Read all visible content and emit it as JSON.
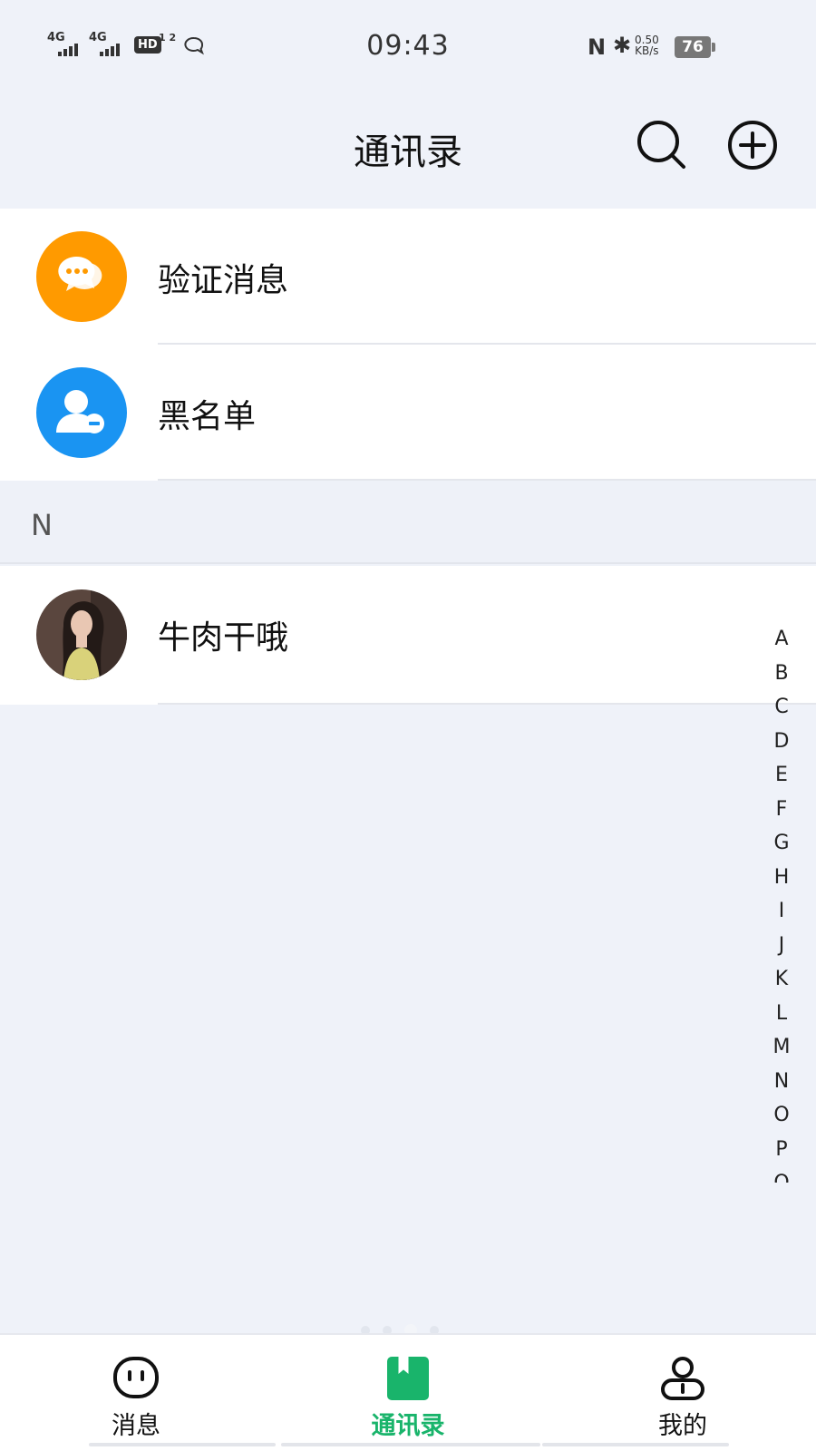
{
  "status_bar": {
    "net1": "4G",
    "net2": "4G",
    "hd": "HD",
    "hd_sub": "1 2",
    "time": "09:43",
    "nfc": "N",
    "bluetooth": "✱",
    "speed_value": "0.50",
    "speed_unit": "KB/s",
    "battery": "76"
  },
  "header": {
    "title": "通讯录"
  },
  "list": {
    "verify_label": "验证消息",
    "blacklist_label": "黑名单",
    "section_letter": "N",
    "contact_name": "牛肉干哦"
  },
  "index_letters": [
    "A",
    "B",
    "C",
    "D",
    "E",
    "F",
    "G",
    "H",
    "I",
    "J",
    "K",
    "L",
    "M",
    "N",
    "O",
    "P",
    "Q"
  ],
  "tabs": [
    {
      "label": "消息",
      "icon": "message-face-icon"
    },
    {
      "label": "通讯录",
      "icon": "contacts-book-icon"
    },
    {
      "label": "我的",
      "icon": "profile-icon"
    }
  ],
  "colors": {
    "accent_green": "#19b46b",
    "verify_orange": "#ff9a00",
    "blacklist_blue": "#1a94f2"
  }
}
